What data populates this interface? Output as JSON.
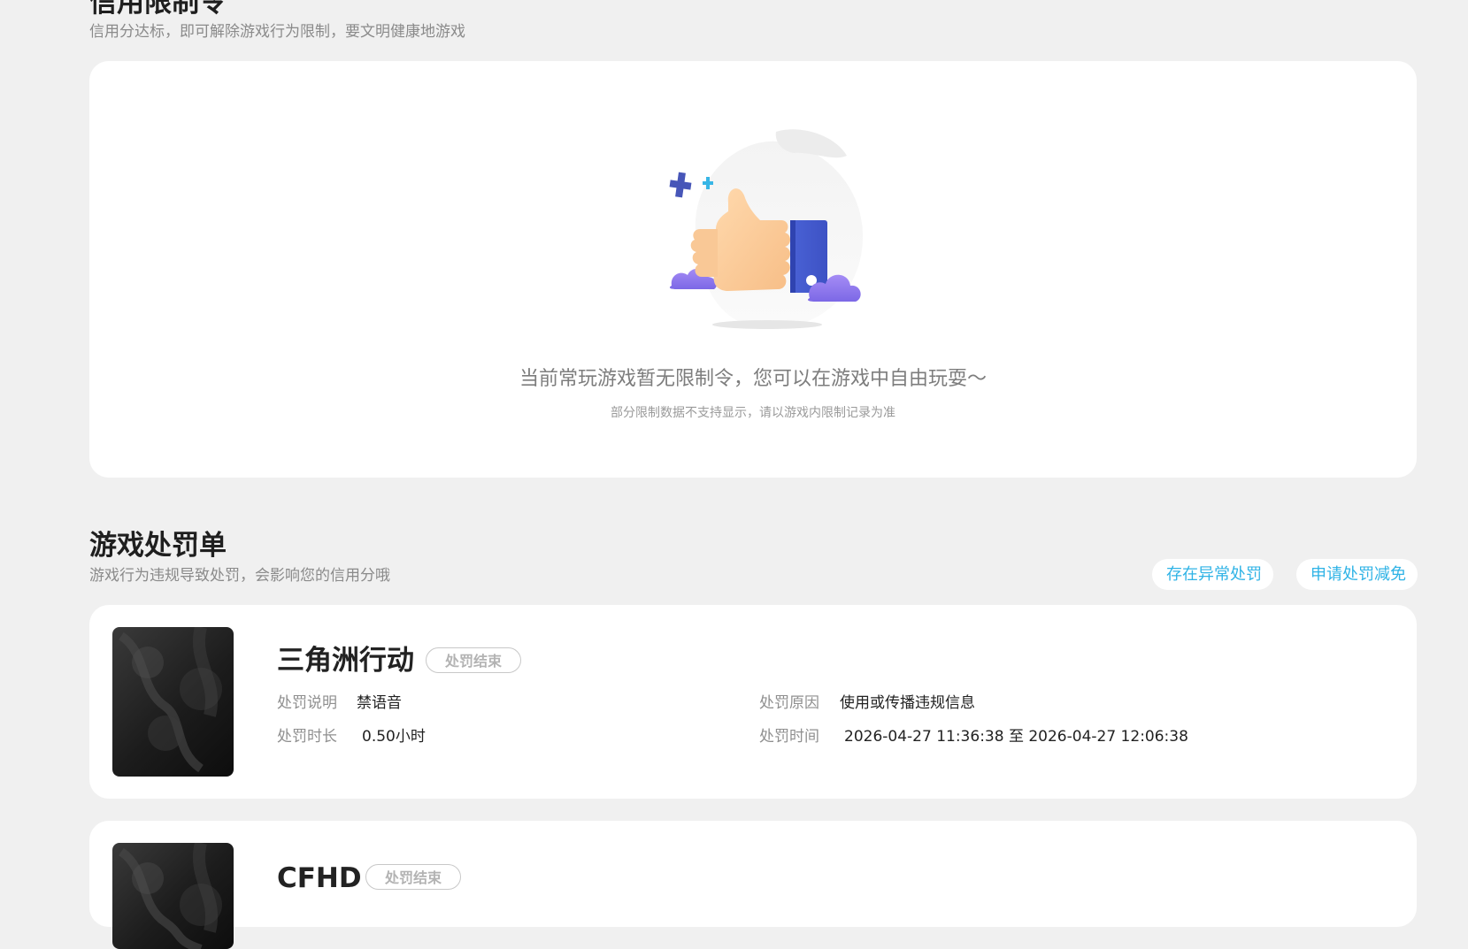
{
  "restriction": {
    "title": "信用限制令",
    "subtitle": "信用分达标，即可解除游戏行为限制，要文明健康地游戏",
    "empty_message": "当前常玩游戏暂无限制令，您可以在游戏中自由玩耍～",
    "empty_hint": "部分限制数据不支持显示，请以游戏内限制记录为准",
    "illustration_icon": "thumbs-up-icon"
  },
  "penalty": {
    "title": "游戏处罚单",
    "subtitle": "游戏行为违规导致处罚，会影响您的信用分哦",
    "abnormal_button": "存在异常处罚",
    "reduce_button": "申请处罚减免",
    "items": [
      {
        "game": "三角洲行动",
        "status": "处罚结束",
        "desc_label": "处罚说明",
        "desc": "禁语音",
        "reason_label": "处罚原因",
        "reason": "使用或传播违规信息",
        "duration_label": "处罚时长",
        "duration": "0.50小时",
        "time_label": "处罚时间",
        "time": "2026-04-27 11:36:38 至 2026-04-27 12:06:38"
      },
      {
        "game": "CFHD",
        "status": "处罚结束"
      }
    ]
  },
  "colors": {
    "accent": "#2fb3e6",
    "background": "#f0f0f0",
    "card": "#ffffff"
  }
}
